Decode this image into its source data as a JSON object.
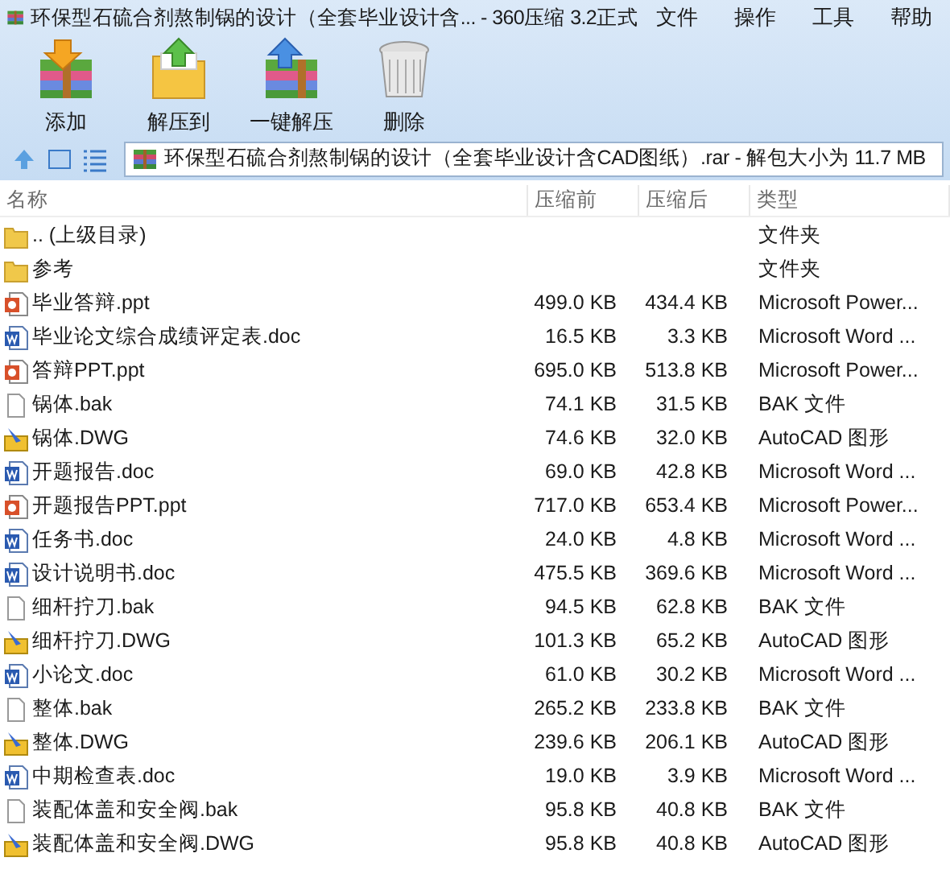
{
  "window": {
    "title": "环保型石硫合剂熬制锅的设计（全套毕业设计含... - 360压缩 3.2正式"
  },
  "menu": [
    "文件",
    "操作",
    "工具",
    "帮助"
  ],
  "toolbar": [
    {
      "label": "添加",
      "kind": "add"
    },
    {
      "label": "解压到",
      "kind": "extract"
    },
    {
      "label": "一键解压",
      "kind": "quick"
    },
    {
      "label": "删除",
      "kind": "delete"
    }
  ],
  "address": {
    "value": "环保型石硫合剂熬制锅的设计（全套毕业设计含CAD图纸）.rar - 解包大小为 11.7 MB"
  },
  "table": {
    "columns": [
      "名称",
      "压缩前",
      "压缩后",
      "类型"
    ],
    "rows": [
      {
        "kind": "folder",
        "name": ".. (上级目录)",
        "type": "文件夹"
      },
      {
        "kind": "folder",
        "name": "参考",
        "type": "文件夹"
      },
      {
        "kind": "ppt",
        "name": "毕业答辩.ppt",
        "before": "499.0 KB",
        "after": "434.4 KB",
        "type": "Microsoft Power..."
      },
      {
        "kind": "doc",
        "name": "毕业论文综合成绩评定表.doc",
        "before": "16.5 KB",
        "after": "3.3 KB",
        "type": "Microsoft Word ..."
      },
      {
        "kind": "ppt",
        "name": "答辩PPT.ppt",
        "before": "695.0 KB",
        "after": "513.8 KB",
        "type": "Microsoft Power..."
      },
      {
        "kind": "bak",
        "name": "锅体.bak",
        "before": "74.1 KB",
        "after": "31.5 KB",
        "type": "BAK 文件"
      },
      {
        "kind": "dwg",
        "name": "锅体.DWG",
        "before": "74.6 KB",
        "after": "32.0 KB",
        "type": "AutoCAD 图形"
      },
      {
        "kind": "doc",
        "name": "开题报告.doc",
        "before": "69.0 KB",
        "after": "42.8 KB",
        "type": "Microsoft Word ..."
      },
      {
        "kind": "ppt",
        "name": "开题报告PPT.ppt",
        "before": "717.0 KB",
        "after": "653.4 KB",
        "type": "Microsoft Power..."
      },
      {
        "kind": "doc",
        "name": "任务书.doc",
        "before": "24.0 KB",
        "after": "4.8 KB",
        "type": "Microsoft Word ..."
      },
      {
        "kind": "doc",
        "name": "设计说明书.doc",
        "before": "475.5 KB",
        "after": "369.6 KB",
        "type": "Microsoft Word ..."
      },
      {
        "kind": "bak",
        "name": "细杆拧刀.bak",
        "before": "94.5 KB",
        "after": "62.8 KB",
        "type": "BAK 文件"
      },
      {
        "kind": "dwg",
        "name": "细杆拧刀.DWG",
        "before": "101.3 KB",
        "after": "65.2 KB",
        "type": "AutoCAD 图形"
      },
      {
        "kind": "doc",
        "name": "小论文.doc",
        "before": "61.0 KB",
        "after": "30.2 KB",
        "type": "Microsoft Word ..."
      },
      {
        "kind": "bak",
        "name": "整体.bak",
        "before": "265.2 KB",
        "after": "233.8 KB",
        "type": "BAK 文件"
      },
      {
        "kind": "dwg",
        "name": "整体.DWG",
        "before": "239.6 KB",
        "after": "206.1 KB",
        "type": "AutoCAD 图形"
      },
      {
        "kind": "doc",
        "name": "中期检查表.doc",
        "before": "19.0 KB",
        "after": "3.9 KB",
        "type": "Microsoft Word ..."
      },
      {
        "kind": "bak",
        "name": "装配体盖和安全阀.bak",
        "before": "95.8 KB",
        "after": "40.8 KB",
        "type": "BAK 文件"
      },
      {
        "kind": "dwg",
        "name": "装配体盖和安全阀.DWG",
        "before": "95.8 KB",
        "after": "40.8 KB",
        "type": "AutoCAD 图形"
      }
    ]
  }
}
